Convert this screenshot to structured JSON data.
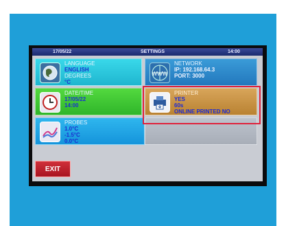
{
  "status_bar": {
    "date": "17/05/22",
    "title": "SETTINGS",
    "time": "14:00"
  },
  "tiles": {
    "language": {
      "heading": "LANGUAGE",
      "value": "ENGLISH",
      "units_heading": "DEGREES",
      "units": "°C",
      "icon": "globe-icon"
    },
    "datetime": {
      "heading": "DATE/TIME",
      "date": "17/05/22",
      "time": "14:00",
      "icon": "clock-icon"
    },
    "probes": {
      "heading": "PROBES",
      "values": [
        "1.0°C",
        "-1.5°C",
        "0.0°C"
      ],
      "icon": "chart-icon"
    },
    "network": {
      "heading": "NETWORK",
      "ip": "IP: 192.168.64.3",
      "port": "PORT: 3000",
      "icon": "www-icon"
    },
    "printer": {
      "heading": "PRINTER",
      "enabled": "YES",
      "interval": "60s",
      "mode": "ONLINE PRINTED NO",
      "icon": "printer-icon"
    }
  },
  "exit_label": "EXIT",
  "colors": {
    "highlight": "#e0203a",
    "label_blue": "#1b2fd0",
    "exit_red": "#c0222c"
  }
}
